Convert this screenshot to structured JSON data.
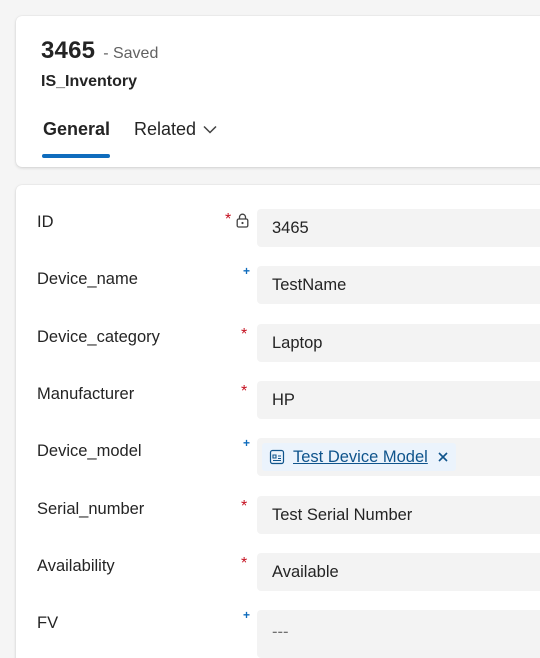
{
  "header": {
    "record_id": "3465",
    "status": "- Saved",
    "entity": "IS_Inventory",
    "tabs": [
      {
        "label": "General"
      },
      {
        "label": "Related"
      }
    ]
  },
  "form": {
    "fields": [
      {
        "label": "ID",
        "value": "3465",
        "required": "*"
      },
      {
        "label": "Device_name",
        "value": "TestName",
        "recommended": "+"
      },
      {
        "label": "Device_category",
        "value": "Laptop",
        "required": "*"
      },
      {
        "label": "Manufacturer",
        "value": "HP",
        "required": "*"
      },
      {
        "label": "Device_model",
        "value": "Test Device Model",
        "recommended": "+"
      },
      {
        "label": "Serial_number",
        "value": "Test Serial Number",
        "required": "*"
      },
      {
        "label": "Availability",
        "value": "Available",
        "required": "*"
      },
      {
        "label": "FV",
        "value": "---",
        "recommended": "+"
      }
    ]
  },
  "colors": {
    "accent": "#0f6cbd",
    "required": "#c50f1f",
    "field_bg": "#f3f3f3",
    "lookup_bg": "#ebf3fc"
  },
  "icons": [
    "lock-icon",
    "chevron-down-icon",
    "entity-record-icon",
    "close-icon"
  ]
}
